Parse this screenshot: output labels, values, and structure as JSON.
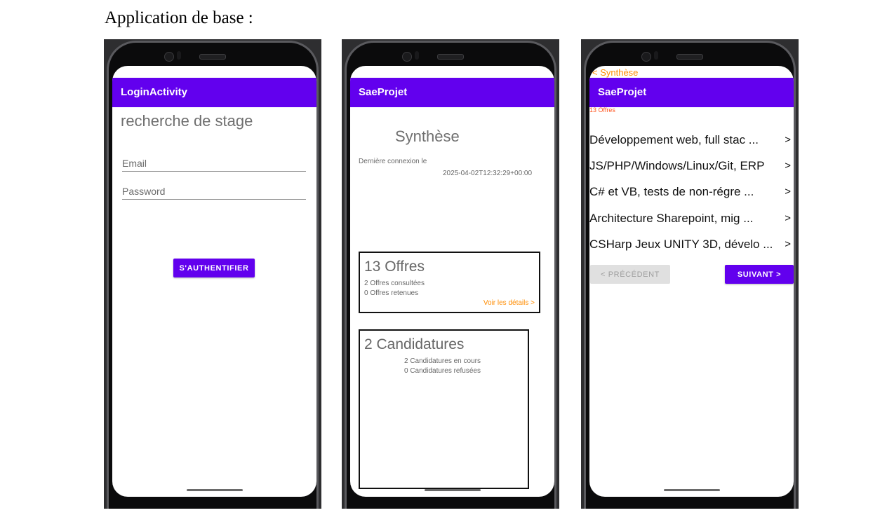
{
  "document": {
    "title": "Application de base :"
  },
  "phone1": {
    "appbar_title": "LoginActivity",
    "heading": "recherche de stage",
    "email_placeholder": "Email",
    "password_placeholder": "Password",
    "auth_button": "S'AUTHENTIFIER"
  },
  "phone2": {
    "appbar_title": "SaeProjet",
    "heading": "Synthèse",
    "last_login_label": "Dernière connexion le",
    "last_login_value": "2025-04-02T12:32:29+00:00",
    "offers_card": {
      "title": "13 Offres",
      "consulted": "2 Offres consultées",
      "retained": "0 Offres retenues",
      "details_link": "Voir les détails >"
    },
    "applications_card": {
      "title": "2 Candidatures",
      "in_progress": "2 Candidatures en cours",
      "refused": "0 Candidatures refusées"
    }
  },
  "phone3": {
    "back_label": "< Synthèse",
    "appbar_title": "SaeProjet",
    "offers_count": "13 Offres",
    "items": [
      {
        "label": "Développement web, full stac ...",
        "arrow": ">"
      },
      {
        "label": "JS/PHP/Windows/Linux/Git, ERP",
        "arrow": ">"
      },
      {
        "label": "C# et VB, tests de non-régre ...",
        "arrow": ">"
      },
      {
        "label": "Architecture Sharepoint, mig ...",
        "arrow": ">"
      },
      {
        "label": "CSHarp Jeux UNITY 3D, dévelo ...",
        "arrow": ">"
      }
    ],
    "prev_button": "< PRÉCÉDENT",
    "next_button": "SUIVANT >"
  },
  "colors": {
    "primary": "#6200ee",
    "accent_orange": "#ff8c00",
    "accent_red": "#ff5722",
    "disabled": "#e0e0e0"
  }
}
